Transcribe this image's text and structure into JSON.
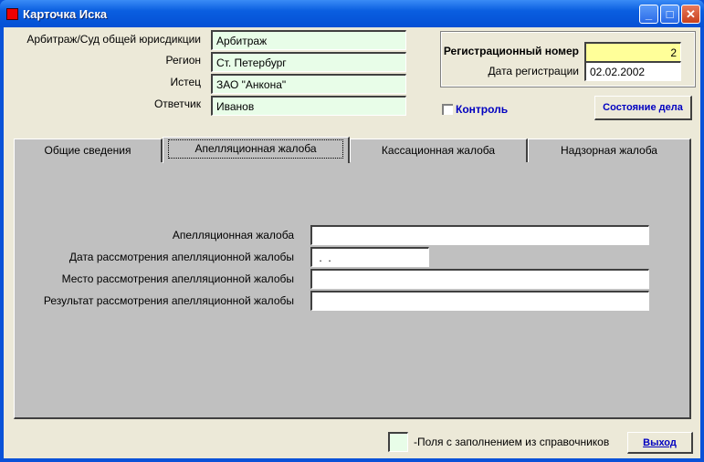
{
  "window": {
    "title": "Карточка Иска",
    "minimize": "_",
    "maximize": "□",
    "close": "✕"
  },
  "header": {
    "fields": [
      {
        "label": "Арбитраж/Суд общей юрисдикции",
        "value": "Арбитраж"
      },
      {
        "label": "Регион",
        "value": "Ст. Петербург"
      },
      {
        "label": "Истец",
        "value": "ЗАО \"Анкона\""
      },
      {
        "label": "Ответчик",
        "value": "Иванов"
      }
    ],
    "reg_number_label": "Регистрационный номер",
    "reg_number": "2",
    "reg_date_label": "Дата регистрации",
    "reg_date": "02.02.2002",
    "control_label": "Контроль",
    "control_checked": false,
    "status_button": "Состояние дела"
  },
  "tabs": [
    {
      "label": "Общие сведения",
      "active": false
    },
    {
      "label": "Апелляционная жалоба",
      "active": true
    },
    {
      "label": "Кассационная жалоба",
      "active": false
    },
    {
      "label": "Надзорная жалоба",
      "active": false
    }
  ],
  "appeal": {
    "fields": [
      {
        "label": "Апелляционная жалоба",
        "value": ""
      },
      {
        "label": "Дата рассмотрения апелляционной жалобы",
        "value": " .  ."
      },
      {
        "label": "Место рассмотрения апелляционной жалобы",
        "value": ""
      },
      {
        "label": "Результат рассмотрения апелляционной жалобы",
        "value": ""
      }
    ]
  },
  "footer": {
    "legend": "-Поля с заполнением из справочников",
    "exit_button": "Выход"
  },
  "colors": {
    "lookup_field": "#e8fde8",
    "reg_number_bg": "#ffff99",
    "titlebar": "#0a5ee0"
  }
}
